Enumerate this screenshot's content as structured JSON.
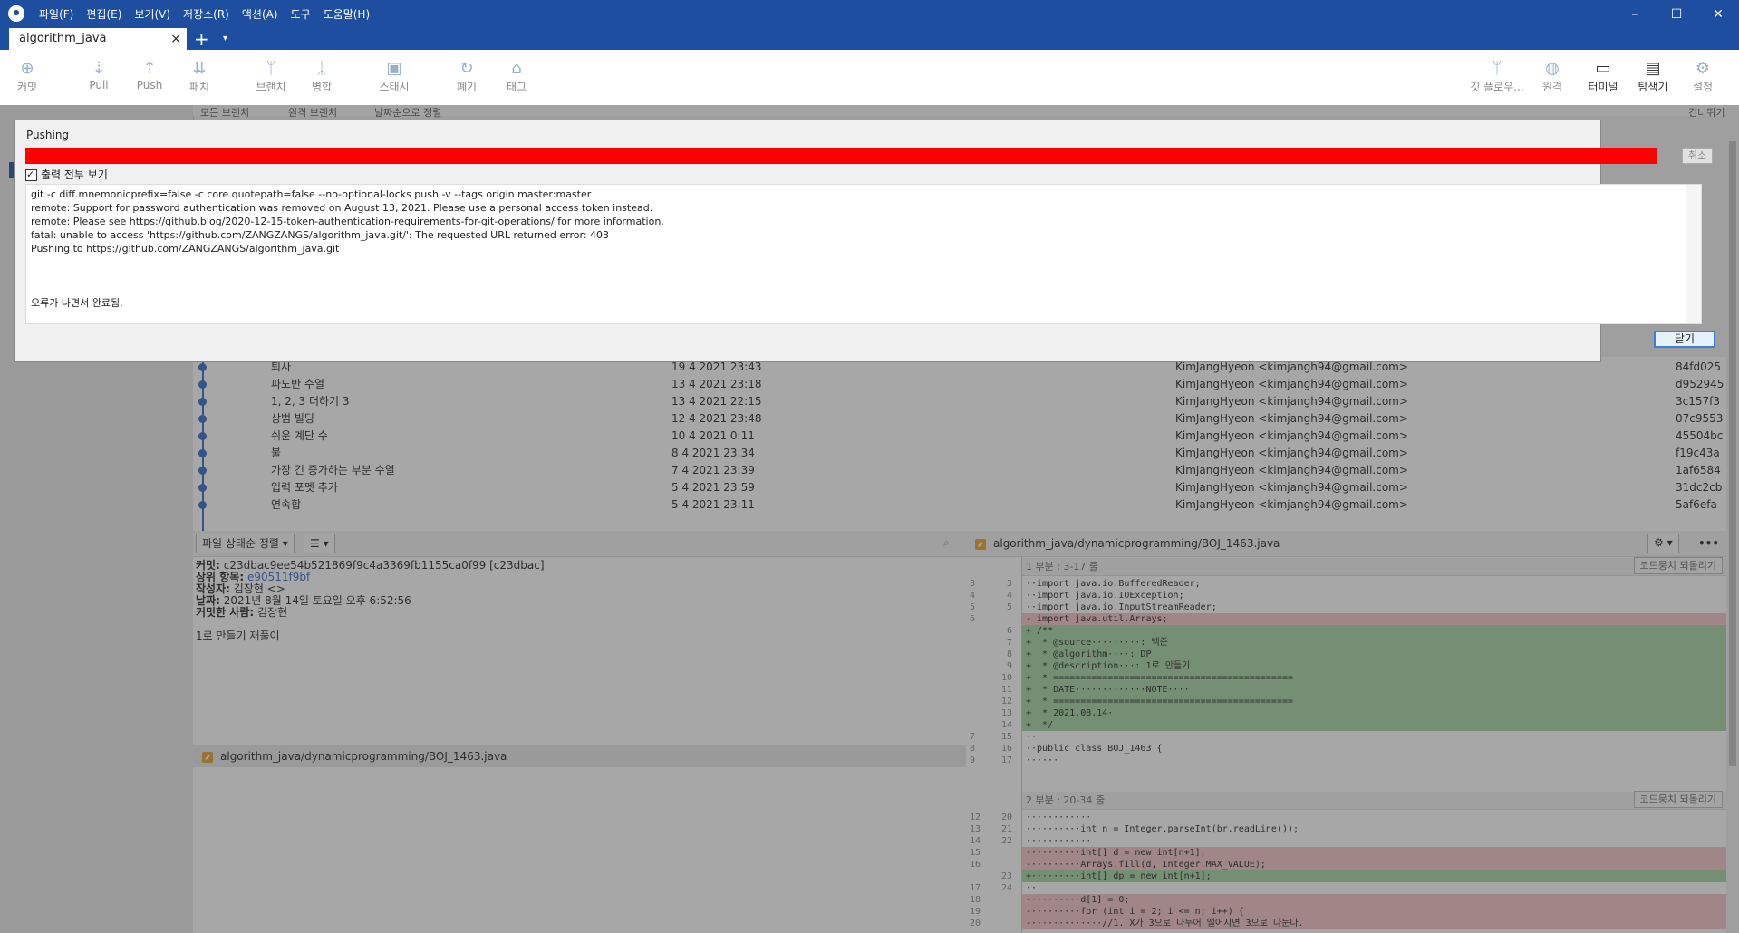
{
  "app": {
    "menus": [
      "파일(F)",
      "편집(E)",
      "보기(V)",
      "저장소(R)",
      "액션(A)",
      "도구",
      "도움말(H)"
    ],
    "window_controls": {
      "minimize": "–",
      "maximize": "☐",
      "close": "✕"
    }
  },
  "tab": {
    "title": "algorithm_java",
    "close": "×",
    "add": "+",
    "dropdown": "▾"
  },
  "toolbar": {
    "left": [
      {
        "label": "커밋",
        "icon": "plus-circle-icon",
        "glyph": "⊕"
      },
      {
        "label": "Pull",
        "icon": "pull-icon",
        "glyph": "⇣"
      },
      {
        "label": "Push",
        "icon": "push-icon",
        "glyph": "⇡"
      },
      {
        "label": "패치",
        "icon": "fetch-icon",
        "glyph": "⇊"
      },
      {
        "label": "브랜치",
        "icon": "branch-icon",
        "glyph": "ᛘ"
      },
      {
        "label": "병합",
        "icon": "merge-icon",
        "glyph": "ᛣ"
      },
      {
        "label": "스태시",
        "icon": "stash-icon",
        "glyph": "▣"
      },
      {
        "label": "폐기",
        "icon": "discard-icon",
        "glyph": "↻"
      },
      {
        "label": "태그",
        "icon": "tag-icon",
        "glyph": "⌂"
      }
    ],
    "right": [
      {
        "label": "깃 플로우...",
        "icon": "git-flow-icon",
        "glyph": "ᛘ"
      },
      {
        "label": "원격",
        "icon": "globe-icon",
        "glyph": "◍"
      },
      {
        "label": "터미널",
        "icon": "terminal-icon",
        "glyph": "▭"
      },
      {
        "label": "탐색기",
        "icon": "folder-icon",
        "glyph": "▤"
      },
      {
        "label": "설정",
        "icon": "gear-icon",
        "glyph": "⚙"
      }
    ]
  },
  "history_bar": {
    "branches": "모든 브랜치",
    "show_remote": "원격 브랜치",
    "sort": "날짜순으로 정렬",
    "jump": "건너뛰기:"
  },
  "history": [
    {
      "message": "퇴사",
      "date": "19 4 2021 23:43",
      "author": "KimJangHyeon <kimjangh94@gmail.com>",
      "hash": "84fd025"
    },
    {
      "message": "파도반 수열",
      "date": "13 4 2021 23:18",
      "author": "KimJangHyeon <kimjangh94@gmail.com>",
      "hash": "d952945"
    },
    {
      "message": "1, 2, 3 더하기 3",
      "date": "13 4 2021 22:15",
      "author": "KimJangHyeon <kimjangh94@gmail.com>",
      "hash": "3c157f3"
    },
    {
      "message": "상범 빌딩",
      "date": "12 4 2021 23:48",
      "author": "KimJangHyeon <kimjangh94@gmail.com>",
      "hash": "07c9553"
    },
    {
      "message": "쉬운 계단 수",
      "date": "10 4 2021 0:11",
      "author": "KimJangHyeon <kimjangh94@gmail.com>",
      "hash": "45504bc"
    },
    {
      "message": "불",
      "date": "8 4 2021 23:34",
      "author": "KimJangHyeon <kimjangh94@gmail.com>",
      "hash": "f19c43a"
    },
    {
      "message": "가장 긴 증가하는 부분 수열",
      "date": "7 4 2021 23:39",
      "author": "KimJangHyeon <kimjangh94@gmail.com>",
      "hash": "1af6584"
    },
    {
      "message": "입력 포멧 추가",
      "date": "5 4 2021 23:59",
      "author": "KimJangHyeon <kimjangh94@gmail.com>",
      "hash": "31dc2cb"
    },
    {
      "message": "연속합",
      "date": "5 4 2021 23:11",
      "author": "KimJangHyeon <kimjangh94@gmail.com>",
      "hash": "5af6efa"
    }
  ],
  "files_panel": {
    "sort": "파일 상태순 정렬",
    "view": "☰",
    "commit": {
      "commit_label": "커밋:",
      "commit_value": "c23dbac9ee54b521869f9c4a3369fb1155ca0f99 [c23dbac]",
      "parent_label": "상위 항목:",
      "parent_value": "e90511f9bf",
      "author_label": "작성자:",
      "author_value": "김장현 <>",
      "date_label": "날짜:",
      "date_value": "2021년 8월 14일 토요일 오후 6:52:56",
      "committer_label": "커밋한 사람:",
      "committer_value": "김장현",
      "message": "1로 만들기 재풀이"
    },
    "file": "algorithm_java/dynamicprogramming/BOJ_1463.java"
  },
  "diff": {
    "file": "algorithm_java/dynamicprogramming/BOJ_1463.java",
    "hunk1": "1 부분 : 3-17 줄",
    "hunk2": "2 부분 : 20-34 줄",
    "revert": "코드뭉치 되돌리기",
    "more": "•••",
    "gear": "⚙ ▾",
    "lines1": [
      {
        "o": "3",
        "n": "3",
        "t": "ctx",
        "s": "··import java.io.BufferedReader;"
      },
      {
        "o": "4",
        "n": "4",
        "t": "ctx",
        "s": "··import java.io.IOException;"
      },
      {
        "o": "5",
        "n": "5",
        "t": "ctx",
        "s": "··import java.io.InputStreamReader;"
      },
      {
        "o": "6",
        "n": "",
        "t": "del",
        "s": "- import java.util.Arrays;"
      },
      {
        "o": "",
        "n": "6",
        "t": "add",
        "s": "+ /**"
      },
      {
        "o": "",
        "n": "7",
        "t": "add",
        "s": "+  * @source·········: 백준"
      },
      {
        "o": "",
        "n": "8",
        "t": "add",
        "s": "+  * @algorithm····: DP"
      },
      {
        "o": "",
        "n": "9",
        "t": "add",
        "s": "+  * @description···: 1로 만들기"
      },
      {
        "o": "",
        "n": "10",
        "t": "add",
        "s": "+  * ============================================"
      },
      {
        "o": "",
        "n": "11",
        "t": "add",
        "s": "+  * DATE·············NOTE····"
      },
      {
        "o": "",
        "n": "12",
        "t": "add",
        "s": "+  * ============================================"
      },
      {
        "o": "",
        "n": "13",
        "t": "add",
        "s": "+  * 2021.08.14·"
      },
      {
        "o": "",
        "n": "14",
        "t": "add",
        "s": "+  */"
      },
      {
        "o": "7",
        "n": "15",
        "t": "ctx",
        "s": "··"
      },
      {
        "o": "8",
        "n": "16",
        "t": "ctx",
        "s": "··public class BOJ_1463 {"
      },
      {
        "o": "9",
        "n": "17",
        "t": "ctx",
        "s": "······"
      }
    ],
    "lines2": [
      {
        "o": "12",
        "n": "20",
        "t": "ctx",
        "s": "············"
      },
      {
        "o": "13",
        "n": "21",
        "t": "ctx",
        "s": "··········int n = Integer.parseInt(br.readLine());"
      },
      {
        "o": "14",
        "n": "22",
        "t": "ctx",
        "s": "············"
      },
      {
        "o": "15",
        "n": "",
        "t": "del",
        "s": "-·········int[] d = new int[n+1];"
      },
      {
        "o": "16",
        "n": "",
        "t": "del",
        "s": "-·········Arrays.fill(d, Integer.MAX_VALUE);"
      },
      {
        "o": "",
        "n": "23",
        "t": "add",
        "s": "+·········int[] dp = new int[n+1];"
      },
      {
        "o": "17",
        "n": "24",
        "t": "ctx",
        "s": "··"
      },
      {
        "o": "18",
        "n": "",
        "t": "del",
        "s": "-·········d[1] = 0;"
      },
      {
        "o": "19",
        "n": "",
        "t": "del",
        "s": "-·········for (int i = 2; i <= n; i++) {"
      },
      {
        "o": "20",
        "n": "",
        "t": "del",
        "s": "-·············//1. X가 3으로 나누어 떨어지면 3으로 나눈다."
      }
    ]
  },
  "dialog": {
    "title": "Pushing",
    "progress": 1.0,
    "progress_color": "#ff0000",
    "cancel": "취소",
    "show_all": "출력 전부 보기",
    "output": [
      "git -c diff.mnemonicprefix=false -c core.quotepath=false --no-optional-locks push -v --tags origin master:master",
      "remote: Support for password authentication was removed on August 13, 2021. Please use a personal access token instead.",
      "remote: Please see https://github.blog/2020-12-15-token-authentication-requirements-for-git-operations/ for more information.",
      "fatal: unable to access 'https://github.com/ZANGZANGS/algorithm_java.git/': The requested URL returned error: 403",
      "Pushing to https://github.com/ZANGZANGS/algorithm_java.git"
    ],
    "status": "오류가 나면서 완료됨.",
    "close": "닫기"
  },
  "colors": {
    "accent": "#1d4ea0",
    "graph": "#2e66c5",
    "add_bg": "#a3d4a0",
    "del_bg": "#f3c4c4"
  }
}
